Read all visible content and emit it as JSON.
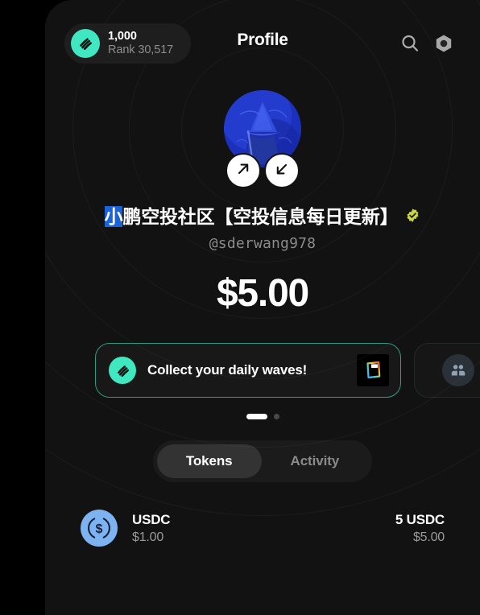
{
  "header": {
    "title": "Profile",
    "points_value": "1,000",
    "points_rank": "Rank 30,517",
    "logo_icon": "wave-logo-icon",
    "search_icon": "search-icon",
    "settings_icon": "hex-gear-icon"
  },
  "profile": {
    "avatar_icon": "wizard-avatar",
    "send_icon": "arrow-up-right-icon",
    "receive_icon": "arrow-down-left-icon",
    "display_name_selected": "小",
    "display_name_rest": "鹏空投社区【空投信息每日更新】",
    "verified_icon": "verified-badge-icon",
    "handle": "@sderwang978",
    "balance": "$5.00"
  },
  "carousel": {
    "promo": {
      "icon": "wave-logo-icon",
      "text": "Collect your daily waves!",
      "thumb_icon": "rainbow-card-icon"
    },
    "secondary": {
      "icon": "group-people-icon"
    },
    "dots": [
      {
        "active": true
      },
      {
        "active": false
      }
    ]
  },
  "tabs": [
    {
      "label": "Tokens",
      "active": true
    },
    {
      "label": "Activity",
      "active": false
    }
  ],
  "tokens": [
    {
      "icon": "usdc-icon",
      "name": "USDC",
      "price": "$1.00",
      "amount": "5 USDC",
      "value": "$5.00"
    }
  ],
  "colors": {
    "accent_teal": "#3FE8C0",
    "promo_border": "#2e9c82",
    "avatar_blue": "#1c33bb",
    "usdc_blue": "#7CB3F0",
    "verified_yellow": "#c9d44a",
    "selection_blue": "#1a63d8",
    "app_bg": "#121212",
    "page_bg": "#000000"
  }
}
